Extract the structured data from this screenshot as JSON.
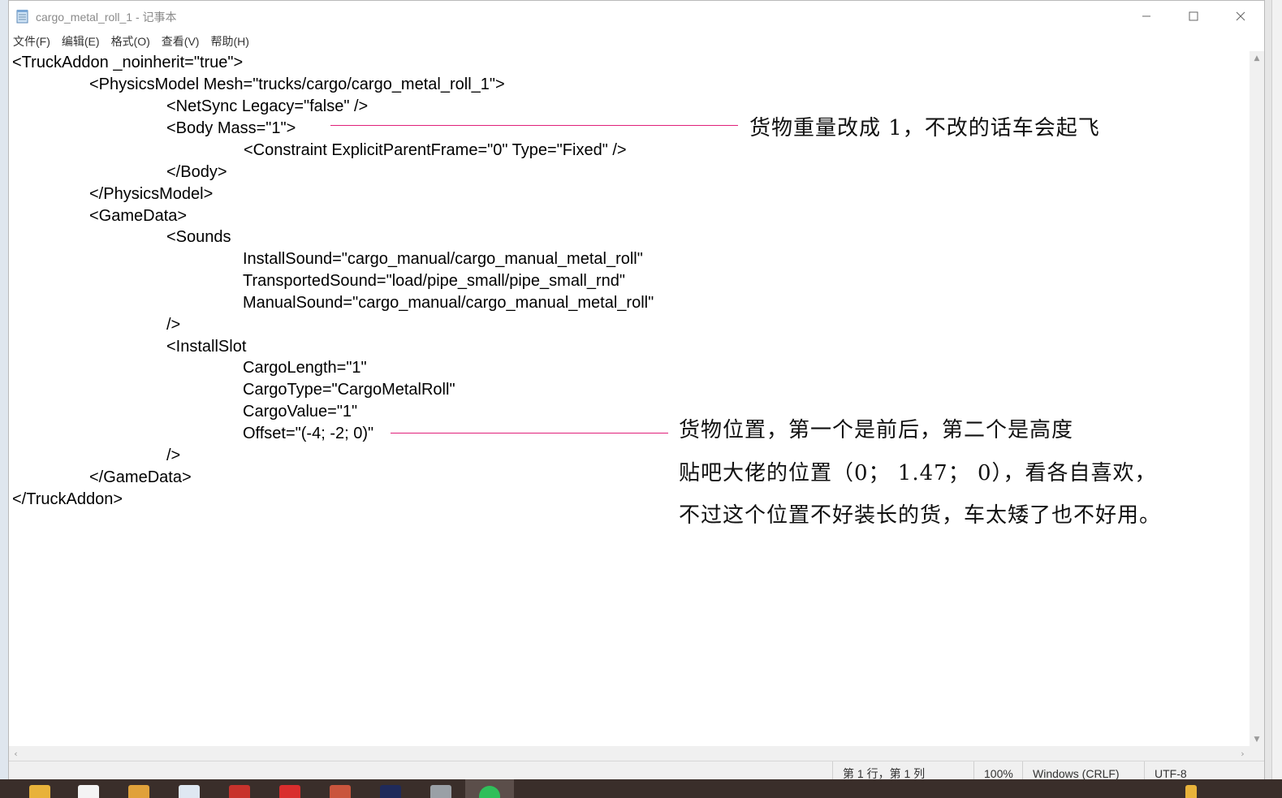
{
  "window": {
    "title": "cargo_metal_roll_1 - 记事本"
  },
  "menu": [
    "文件(F)",
    "编辑(E)",
    "格式(O)",
    "查看(V)",
    "帮助(H)"
  ],
  "code_lines": [
    "<TruckAddon _noinherit=\"true\">",
    "<PhysicsModel Mesh=\"trucks/cargo/cargo_metal_roll_1\">",
    "<NetSync Legacy=\"false\" />",
    "<Body Mass=\"1\">",
    "<Constraint ExplicitParentFrame=\"0\" Type=\"Fixed\" />",
    "</Body>",
    "</PhysicsModel>",
    "<GameData>",
    "<Sounds",
    "InstallSound=\"cargo_manual/cargo_manual_metal_roll\"",
    "TransportedSound=\"load/pipe_small/pipe_small_rnd\"",
    "ManualSound=\"cargo_manual/cargo_manual_metal_roll\"",
    "/>",
    "<InstallSlot",
    "CargoLength=\"1\"",
    "CargoType=\"CargoMetalRoll\"",
    "CargoValue=\"1\"",
    "Offset=\"(-4; -2; 0)\"",
    "/>",
    "</GameData>",
    "</TruckAddon>"
  ],
  "annotations": {
    "mass_note": "货物重量改成 1，不改的话车会起飞",
    "offset_note_1": "货物位置，第一个是前后，第二个是高度",
    "offset_note_2": "贴吧大佬的位置（0； 1.47； 0），看各自喜欢，",
    "offset_note_3": "不过这个位置不好装长的货，车太矮了也不好用。"
  },
  "status": {
    "position": "第 1 行，第 1 列",
    "zoom": "100%",
    "line_ending": "Windows (CRLF)",
    "encoding": "UTF-8"
  },
  "colors": {
    "annotation_line": "#e0207a",
    "taskbar": "#3a2e2a"
  },
  "icons": {
    "app": "notepad-icon",
    "minimize": "minimize-icon",
    "maximize": "maximize-icon",
    "close": "close-icon"
  }
}
